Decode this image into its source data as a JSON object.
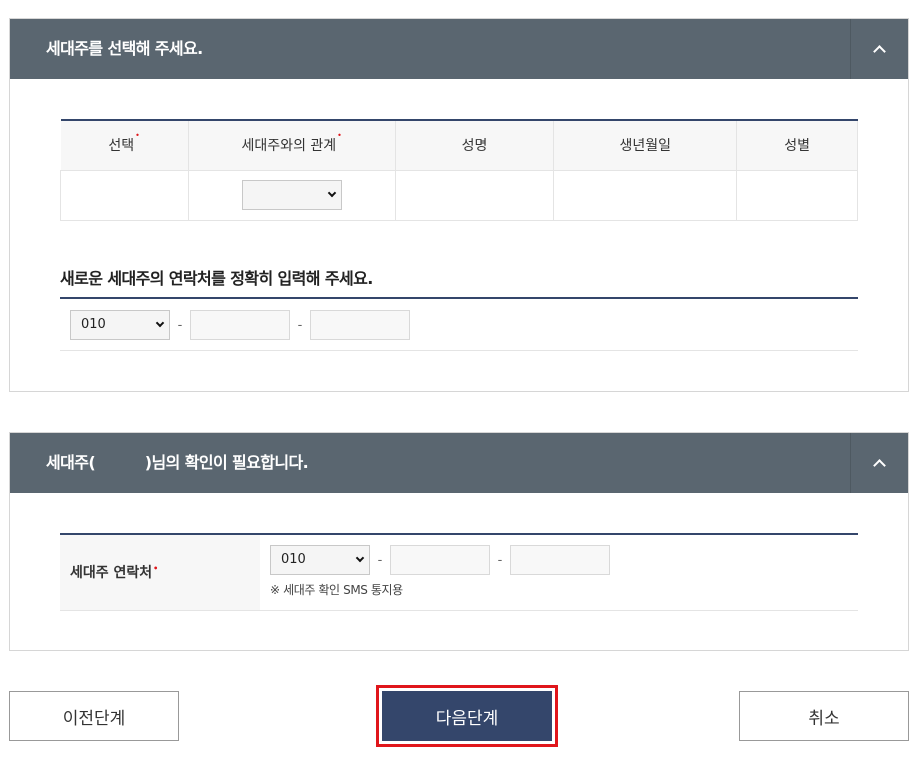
{
  "panel1": {
    "title": "세대주를 선택해 주세요.",
    "toggle_icon": "chevron-up-icon",
    "table": {
      "headers": [
        "선택",
        "세대주와의 관계",
        "성명",
        "생년월일",
        "성별"
      ],
      "required_marker": "•",
      "relation_select_value": ""
    },
    "contact_heading": "새로운 세대주의 연락처를 정확히 입력해 주세요.",
    "phone": {
      "prefix": "010",
      "dash": "-"
    }
  },
  "panel2": {
    "title": "세대주(          )님의 확인이 필요합니다.",
    "toggle_icon": "chevron-up-icon",
    "label": "세대주 연락처",
    "required_marker": "•",
    "phone": {
      "prefix": "010",
      "dash": "-"
    },
    "note": "※ 세대주 확인 SMS 통지용"
  },
  "buttons": {
    "prev": "이전단계",
    "next": "다음단계",
    "cancel": "취소"
  },
  "colors": {
    "header_bg": "#5a6670",
    "accent_navy": "#34466b",
    "required_red": "#e0161b",
    "highlight_border": "#e0161b"
  }
}
